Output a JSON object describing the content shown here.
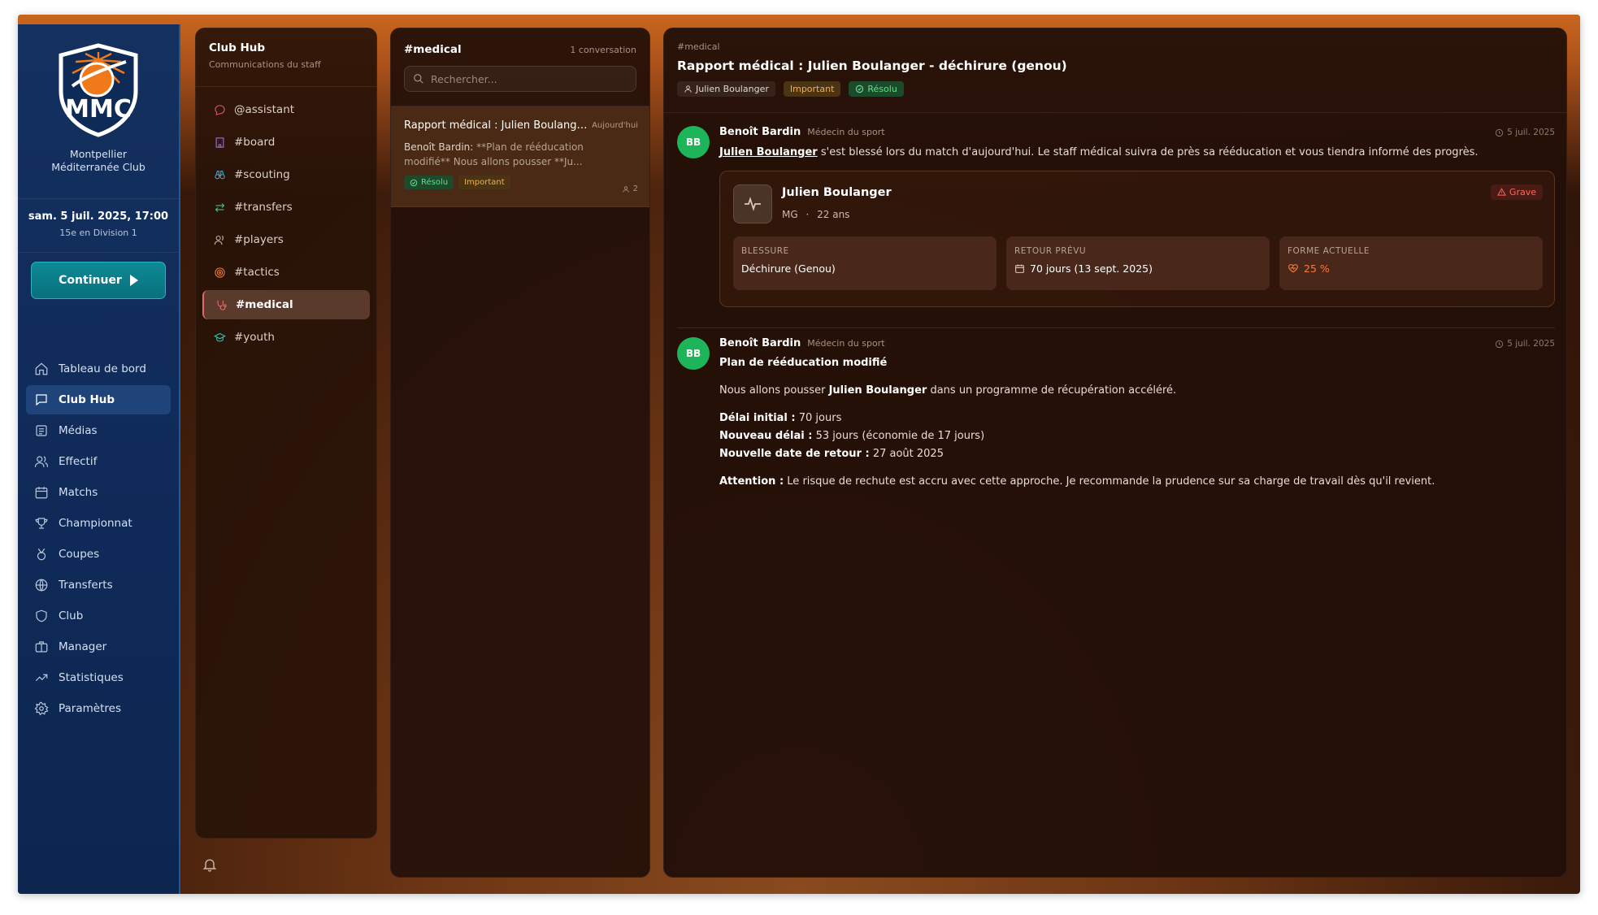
{
  "sidebar": {
    "club_line1": "Montpellier",
    "club_line2": "Méditerranée Club",
    "date": "sam. 5 juil. 2025, 17:00",
    "standing": "15e en Division 1",
    "continue_label": "Continuer",
    "nav": [
      {
        "label": "Tableau de bord",
        "icon": "home-icon"
      },
      {
        "label": "Club Hub",
        "icon": "chat-icon",
        "active": true
      },
      {
        "label": "Médias",
        "icon": "newspaper-icon"
      },
      {
        "label": "Effectif",
        "icon": "users-icon"
      },
      {
        "label": "Matchs",
        "icon": "calendar-icon"
      },
      {
        "label": "Championnat",
        "icon": "trophy-icon"
      },
      {
        "label": "Coupes",
        "icon": "medal-icon"
      },
      {
        "label": "Transferts",
        "icon": "globe-icon"
      },
      {
        "label": "Club",
        "icon": "shield-icon"
      },
      {
        "label": "Manager",
        "icon": "briefcase-icon"
      },
      {
        "label": "Statistiques",
        "icon": "trend-icon"
      },
      {
        "label": "Paramètres",
        "icon": "gear-icon"
      }
    ]
  },
  "channels": {
    "title": "Club Hub",
    "subtitle": "Communications du staff",
    "items": [
      {
        "label": "@assistant",
        "icon": "bubble-icon",
        "color": "#e0507a"
      },
      {
        "label": "#board",
        "icon": "building-icon",
        "color": "#9a7ae0"
      },
      {
        "label": "#scouting",
        "icon": "binoculars-icon",
        "color": "#3ab0e0"
      },
      {
        "label": "#transfers",
        "icon": "arrows-icon",
        "color": "#3ad07a"
      },
      {
        "label": "#players",
        "icon": "users-icon",
        "color": "#c8b8a8"
      },
      {
        "label": "#tactics",
        "icon": "target-icon",
        "color": "#f07a30"
      },
      {
        "label": "#medical",
        "icon": "stethoscope-icon",
        "color": "#f06a6a",
        "active": true
      },
      {
        "label": "#youth",
        "icon": "grad-cap-icon",
        "color": "#30c8b0"
      }
    ]
  },
  "conversations": {
    "title": "#medical",
    "count": "1 conversation",
    "search_placeholder": "Rechercher...",
    "items": [
      {
        "title": "Rapport médical : Julien Boulange...",
        "time": "Aujourd'hui",
        "preview_author": "Benoît Bardin:",
        "preview_text": "**Plan de rééducation modifié** Nous allons pousser **Ju...",
        "badge_resolved": "Résolu",
        "badge_important": "Important",
        "participants": "2"
      }
    ]
  },
  "detail": {
    "channel": "#medical",
    "title": "Rapport médical : Julien Boulanger - déchirure (genou)",
    "tag_player": "Julien Boulanger",
    "tag_important": "Important",
    "tag_resolved": "Résolu",
    "messages": [
      {
        "avatar": "BB",
        "author": "Benoît Bardin",
        "role": "Médecin du sport",
        "date": "5 juil. 2025",
        "player_link": "Julien Boulanger",
        "text": "s'est blessé lors du match d'aujourd'hui. Le staff médical suivra de près sa rééducation et vous tiendra informé des progrès.",
        "card": {
          "name": "Julien Boulanger",
          "position": "MG",
          "separator": "·",
          "age": "22 ans",
          "severity": "Grave",
          "injury_label": "BLESSURE",
          "injury_value": "Déchirure (Genou)",
          "return_label": "RETOUR PRÉVU",
          "return_value": "70 jours (13 sept. 2025)",
          "form_label": "FORME ACTUELLE",
          "form_value": "25 %"
        }
      },
      {
        "avatar": "BB",
        "author": "Benoît Bardin",
        "role": "Médecin du sport",
        "date": "5 juil. 2025",
        "heading": "Plan de rééducation modifié",
        "p1_a": "Nous allons pousser",
        "p1_b": "Julien Boulanger",
        "p1_c": "dans un programme de récupération accéléré.",
        "l1_k": "Délai initial :",
        "l1_v": "70 jours",
        "l2_k": "Nouveau délai :",
        "l2_v": "53 jours (économie de 17 jours)",
        "l3_k": "Nouvelle date de retour :",
        "l3_v": "27 août 2025",
        "warn_k": "Attention :",
        "warn_v": "Le risque de rechute est accru avec cette approche. Je recommande la prudence sur sa charge de travail dès qu'il revient."
      }
    ]
  },
  "colors": {
    "sidebar_bg": "#0f2a58",
    "accent_teal": "#0a7c88",
    "avatar_green": "#1eb55a",
    "badge_green": "#5fe08a",
    "badge_amber": "#f0b050",
    "danger": "#ff6a5a"
  }
}
